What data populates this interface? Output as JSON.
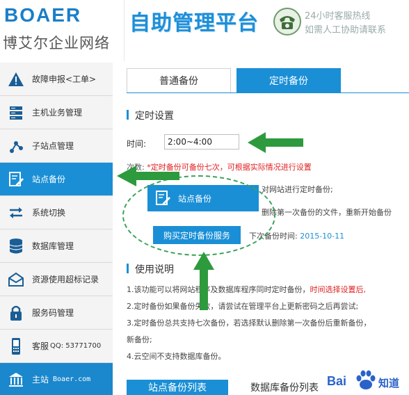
{
  "header": {
    "logo_en": "BOAER",
    "logo_cn": "博艾尔企业网络",
    "platform_title": "自助管理平台",
    "hotline": "24小时客服热线",
    "hotline_sub": "如需人工协助请联系"
  },
  "sidebar": {
    "items": [
      {
        "label": "故障申报<工单>",
        "icon": "warning-icon"
      },
      {
        "label": "主机业务管理",
        "icon": "server-icon"
      },
      {
        "label": "子站点管理",
        "icon": "substation-icon"
      },
      {
        "label": "站点备份",
        "icon": "backup-icon"
      },
      {
        "label": "系统切换",
        "icon": "switch-icon"
      },
      {
        "label": "数据库管理",
        "icon": "database-icon"
      },
      {
        "label": "资源使用超标记录",
        "icon": "mail-icon"
      },
      {
        "label": "服务码管理",
        "icon": "lock-icon"
      },
      {
        "label": "客服",
        "qq": "QQ: 53771700",
        "icon": "phone-icon"
      },
      {
        "label": "主站",
        "site": "Boaer.com",
        "icon": "bank-icon"
      }
    ]
  },
  "tabs": {
    "normal": "普通备份",
    "timed": "定时备份"
  },
  "timing": {
    "heading": "定时设置",
    "time_label": "时间:",
    "time_value": "2:00~4:00",
    "notice_prefix": "次数: ",
    "notice_red": "*定时备份可备份七次，可根据实际情况进行设置"
  },
  "fragments": {
    "line1": "对网站进行定时备份;",
    "line2": "删除第一次备份的文件，重新开始备份",
    "next_label": "下次备份时间:",
    "next_date": "2015-10-11"
  },
  "popup": {
    "label": "站点备份"
  },
  "buy_button": "购买定时备份服务",
  "instructions": {
    "heading": "使用说明",
    "line1_a": "1.该功能可以将网站程序及数据库程序同时定时备份，",
    "line1_b": "时间选择设置后,",
    "line2": "2.定时备份如果备份失败，请尝试在管理平台上更新密码之后再尝试;",
    "line3": "3.定时备份总共支持七次备份，若选择默认删除第一次备份后重新备份，",
    "line3b": "新备份;",
    "line4": "4.云空间不支持数据库备份。"
  },
  "bottom_tabs": {
    "site_list": "站点备份列表",
    "db_list": "数据库备份列表"
  },
  "watermark": {
    "bai": "Bai",
    "zhidao": "知道"
  },
  "colors": {
    "primary": "#1a8fd6",
    "accent_red": "#e02020",
    "arrow_green": "#2e9a3e"
  }
}
